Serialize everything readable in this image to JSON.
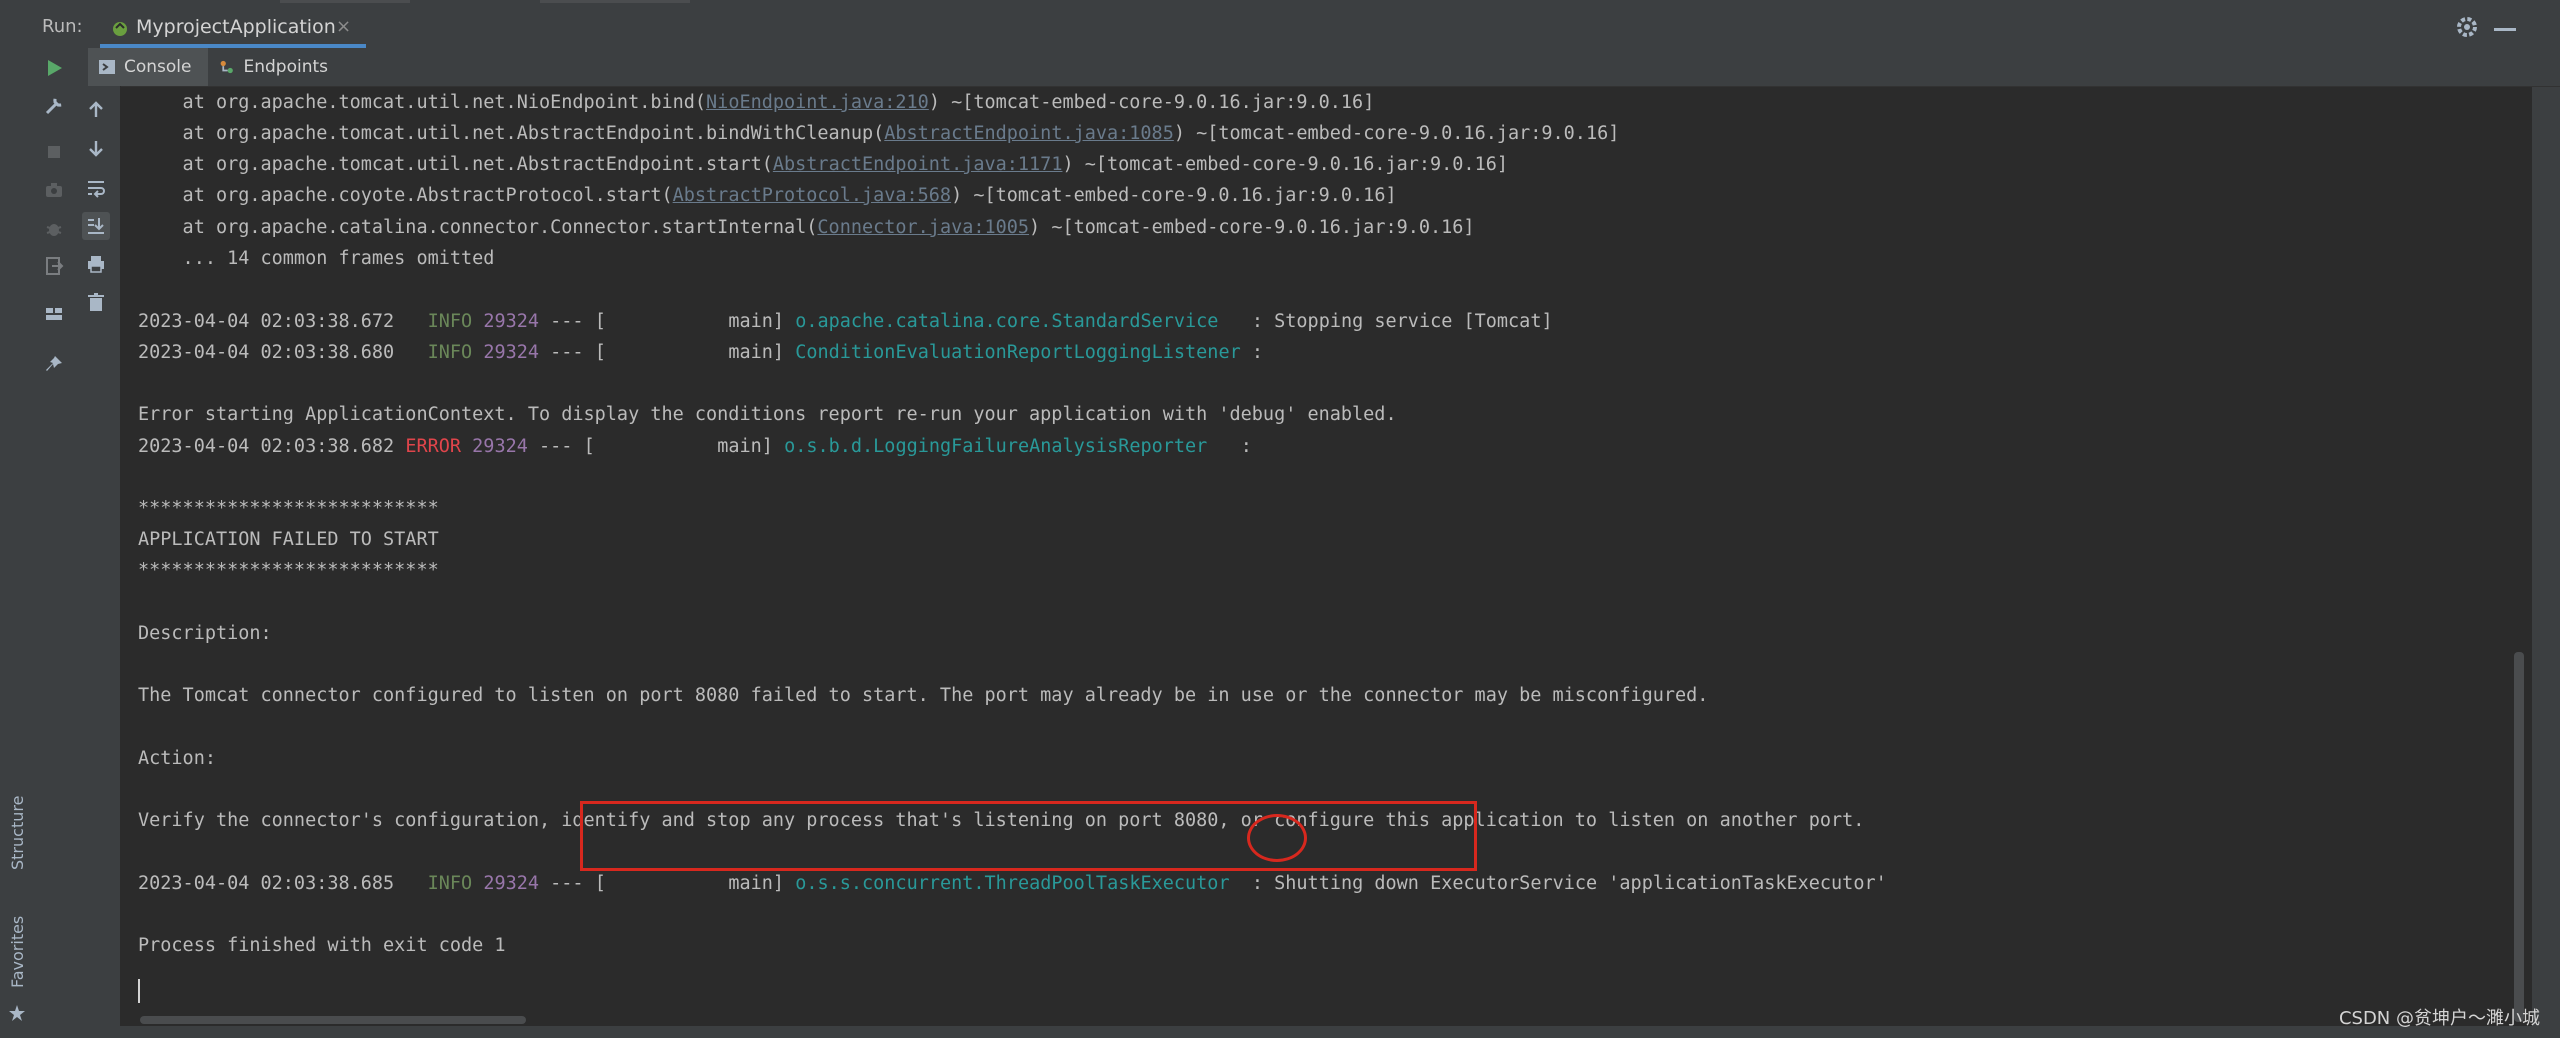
{
  "run_panel": {
    "label": "Run:",
    "tab_title": "MyprojectApplication",
    "close_glyph": "×"
  },
  "subtabs": [
    {
      "label": "Console",
      "icon": "console-icon",
      "active": true
    },
    {
      "label": "Endpoints",
      "icon": "endpoints-icon",
      "active": false
    }
  ],
  "side_labels": {
    "structure": "Structure",
    "favorites": "Favorites"
  },
  "console": {
    "stack": [
      {
        "before": "    at org.apache.tomcat.util.net.NioEndpoint.bind(",
        "link": "NioEndpoint.java:210",
        "after": ") ~[tomcat-embed-core-9.0.16.jar:9.0.16]"
      },
      {
        "before": "    at org.apache.tomcat.util.net.AbstractEndpoint.bindWithCleanup(",
        "link": "AbstractEndpoint.java:1085",
        "after": ") ~[tomcat-embed-core-9.0.16.jar:9.0.16]"
      },
      {
        "before": "    at org.apache.tomcat.util.net.AbstractEndpoint.start(",
        "link": "AbstractEndpoint.java:1171",
        "after": ") ~[tomcat-embed-core-9.0.16.jar:9.0.16]"
      },
      {
        "before": "    at org.apache.coyote.AbstractProtocol.start(",
        "link": "AbstractProtocol.java:568",
        "after": ") ~[tomcat-embed-core-9.0.16.jar:9.0.16]"
      },
      {
        "before": "    at org.apache.catalina.connector.Connector.startInternal(",
        "link": "Connector.java:1005",
        "after": ") ~[tomcat-embed-core-9.0.16.jar:9.0.16]"
      }
    ],
    "omitted": "    ... 14 common frames omitted",
    "logs": [
      {
        "ts": "2023-04-04 02:03:38.672",
        "level": " INFO",
        "pid": "29324",
        "sep": " --- [           main] ",
        "cls": "o.apache.catalina.core.StandardService  ",
        "msg": " : Stopping service [Tomcat]"
      },
      {
        "ts": "2023-04-04 02:03:38.680",
        "level": " INFO",
        "pid": "29324",
        "sep": " --- [           main] ",
        "cls": "ConditionEvaluationReportLoggingListener",
        "msg": " :"
      },
      {
        "ts": "2023-04-04 02:03:38.682",
        "level": "ERROR",
        "pid": "29324",
        "sep": " --- [           main] ",
        "cls": "o.s.b.d.LoggingFailureAnalysisReporter  ",
        "msg": " :"
      },
      {
        "ts": "2023-04-04 02:03:38.685",
        "level": " INFO",
        "pid": "29324",
        "sep": " --- [           main] ",
        "cls": "o.s.s.concurrent.ThreadPoolTaskExecutor ",
        "msg": " : Shutting down ExecutorService 'applicationTaskExecutor'"
      }
    ],
    "error_context": "Error starting ApplicationContext. To display the conditions report re-run your application with 'debug' enabled.",
    "stars": "***************************",
    "failed": "APPLICATION FAILED TO START",
    "description_label": "Description:",
    "description": "The Tomcat connector configured to listen on port 8080 failed to start. The port may already be in use or the connector may be misconfigured.",
    "action_label": "Action:",
    "action": "Verify the connector's configuration, identify and stop any process that's listening on port 8080, or configure this application to listen on another port.",
    "exit": "Process finished with exit code 1"
  },
  "watermark": "CSDN @贫坤户～濉小城",
  "colors": {
    "info": "#6a8759",
    "error": "#e0454b",
    "pid": "#9876aa",
    "class": "#299999",
    "link": "#6a7b8c",
    "annotation": "#d7281e"
  }
}
